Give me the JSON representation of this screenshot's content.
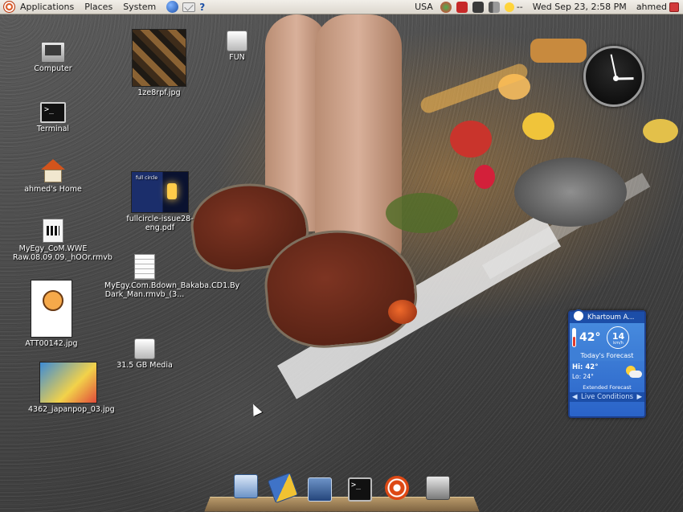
{
  "top_panel": {
    "menus": [
      "Applications",
      "Places",
      "System"
    ],
    "keyboard_layout": "USA",
    "weather_applet": "--",
    "datetime": "Wed Sep 23,  2:58 PM",
    "username": "ahmed"
  },
  "desktop_icons": [
    {
      "label": "Computer",
      "icon": "computer-icon"
    },
    {
      "label": "Terminal",
      "icon": "terminal-icon"
    },
    {
      "label": "ahmed's Home",
      "icon": "home-folder-icon"
    },
    {
      "label": "MyEgy_CoM.WWE Raw.08.09.09._hOOr.rmvb",
      "icon": "video-file-icon"
    },
    {
      "label": "ATT00142.jpg",
      "icon": "image-thumbnail"
    },
    {
      "label": "4362_japanpop_03.jpg",
      "icon": "image-thumbnail"
    },
    {
      "label": "1ze8rpf.jpg",
      "icon": "image-thumbnail"
    },
    {
      "label": "FUN",
      "icon": "drive-icon"
    },
    {
      "label": "fullcircle-issue28-eng.pdf",
      "icon": "pdf-thumbnail"
    },
    {
      "label": "MyEgy.Com.Bdown_Bakaba.CD1.By Dark_Man.rmvb_(3...",
      "icon": "text-document-icon"
    },
    {
      "label": "31.5 GB Media",
      "icon": "drive-icon"
    }
  ],
  "thumb_text": {
    "pdf_title": "full circle"
  },
  "clock": {
    "hours": 2,
    "minutes": 58
  },
  "weather_widget": {
    "location": "Khartoum A...",
    "temperature": "42°",
    "wind_speed": "14",
    "wind_unit": "km/h",
    "forecast_title": "Today's Forecast",
    "high": "Hi: 42°",
    "low": "Lo: 24°",
    "extended": "Extended Forecast",
    "live": "Live Conditions"
  },
  "dock": {
    "items": [
      "files-icon",
      "text-editor-icon",
      "window-icon",
      "terminal-icon",
      "ubuntu-icon",
      "media-drive-icon"
    ]
  },
  "colors": {
    "panel": "#dcd7ce",
    "weather_blue": "#2a63c8",
    "ubuntu_orange": "#dd4814"
  }
}
